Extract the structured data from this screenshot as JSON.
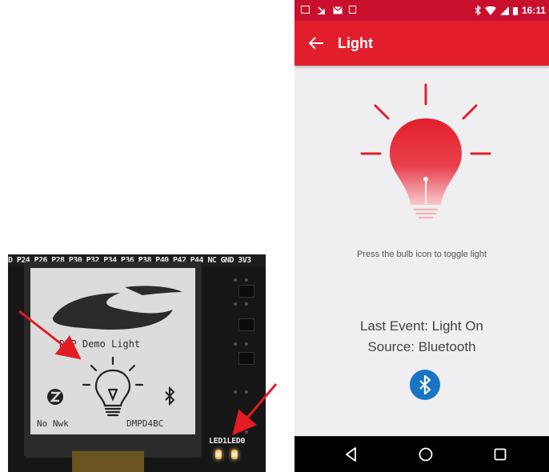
{
  "board": {
    "pin_header": "D P24 P26 P28 P30 P32 P34 P36 P38 P40 P42 P44  NC  GND 3V3",
    "lcd_title": "DMP Demo Light",
    "lcd_left_status": "No Nwk",
    "lcd_right_status": "DMPD4BC",
    "led_labels": "LED1LED0",
    "arrow_color": "#e31b23"
  },
  "phone": {
    "status_bar": {
      "time": "16:11",
      "left_icons": [
        "image-icon",
        "download-icon",
        "mail-icon",
        "sim-icon"
      ],
      "right_icons": [
        "bluetooth-icon",
        "wifi-icon",
        "signal-icon",
        "battery-icon"
      ]
    },
    "app_bar": {
      "title": "Light",
      "back_icon": "back-arrow-icon"
    },
    "bulb": {
      "icon": "lightbulb-icon",
      "color": "#e21e2d",
      "state": "on"
    },
    "hint": "Press the bulb icon to toggle light",
    "last_event": "Last Event: Light On",
    "source": "Source: Bluetooth",
    "source_icon": "bluetooth-icon",
    "nav_bar": {
      "back": "back-triangle-icon",
      "home": "home-circle-icon",
      "recents": "recents-square-icon"
    },
    "colors": {
      "status_bar": "#c8102e",
      "app_bar": "#e21e2d",
      "background": "#efeef0",
      "bluetooth_button": "#1a74c4"
    }
  }
}
